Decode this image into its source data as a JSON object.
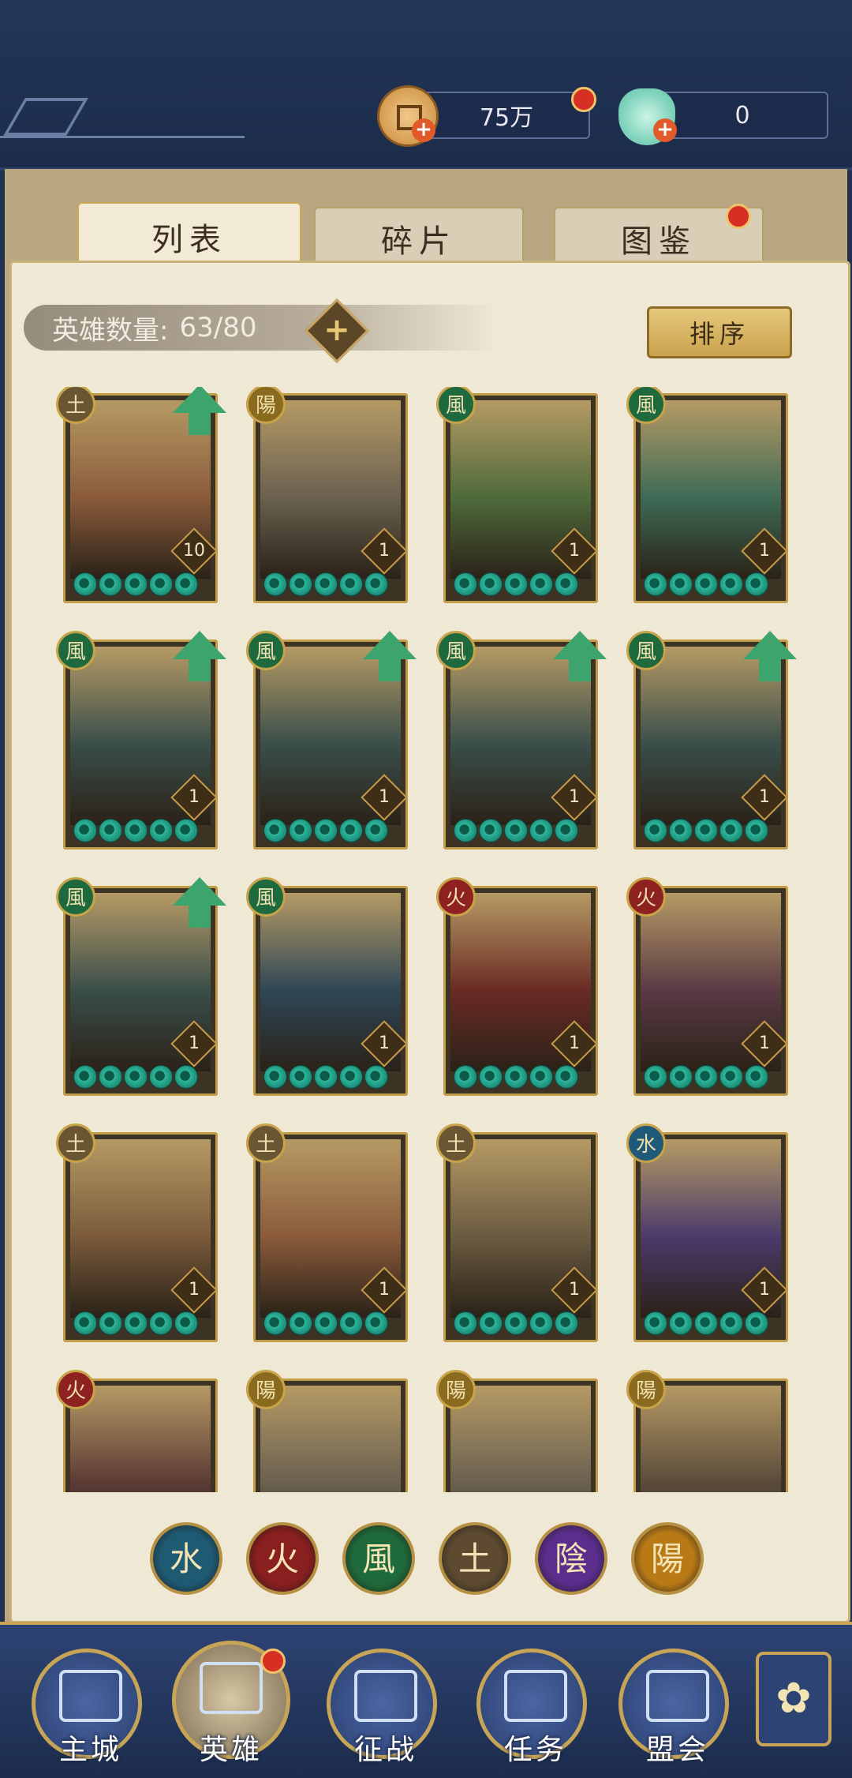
{
  "currencies": [
    {
      "name": "coin",
      "value": "75万",
      "icon": "copper-coin-icon"
    },
    {
      "name": "jade",
      "value": "0",
      "icon": "jade-shell-icon"
    }
  ],
  "tabs": [
    {
      "label": "列表",
      "active": true
    },
    {
      "label": "碎片",
      "active": false
    },
    {
      "label": "图鉴",
      "active": false,
      "has_dot": true
    }
  ],
  "hero_count": {
    "label": "英雄数量:",
    "value": "63/80"
  },
  "sort_label": "排序",
  "heroes": [
    {
      "element": "土",
      "level": "10",
      "upgrade": true
    },
    {
      "element": "陽",
      "level": "1",
      "upgrade": false
    },
    {
      "element": "風",
      "level": "1",
      "upgrade": false
    },
    {
      "element": "風",
      "level": "1",
      "upgrade": false
    },
    {
      "element": "風",
      "level": "1",
      "upgrade": true
    },
    {
      "element": "風",
      "level": "1",
      "upgrade": true
    },
    {
      "element": "風",
      "level": "1",
      "upgrade": true
    },
    {
      "element": "風",
      "level": "1",
      "upgrade": true
    },
    {
      "element": "風",
      "level": "1",
      "upgrade": true
    },
    {
      "element": "風",
      "level": "1",
      "upgrade": false
    },
    {
      "element": "火",
      "level": "1",
      "upgrade": false
    },
    {
      "element": "火",
      "level": "1",
      "upgrade": false
    },
    {
      "element": "土",
      "level": "1",
      "upgrade": false
    },
    {
      "element": "土",
      "level": "1",
      "upgrade": false
    },
    {
      "element": "土",
      "level": "1",
      "upgrade": false
    },
    {
      "element": "水",
      "level": "1",
      "upgrade": false
    },
    {
      "element": "火",
      "level": "",
      "upgrade": false
    },
    {
      "element": "陽",
      "level": "",
      "upgrade": false
    },
    {
      "element": "陽",
      "level": "",
      "upgrade": false
    },
    {
      "element": "陽",
      "level": "",
      "upgrade": false
    }
  ],
  "filters": [
    {
      "glyph": "水",
      "color": "#1f5a73"
    },
    {
      "glyph": "火",
      "color": "#8a1f1f"
    },
    {
      "glyph": "風",
      "color": "#1f6a3a"
    },
    {
      "glyph": "土",
      "color": "#5d4a30"
    },
    {
      "glyph": "陰",
      "color": "#5b2d8c"
    },
    {
      "glyph": "陽",
      "color": "#b97a16"
    }
  ],
  "element_colors": {
    "土": "#6b5634",
    "陽": "#8a6a1e",
    "風": "#1e6a3e",
    "火": "#8e2220",
    "水": "#1f5a78"
  },
  "nav": [
    {
      "label": "主城",
      "icon": "city-gate-icon"
    },
    {
      "label": "英雄",
      "icon": "hero-portrait-icon",
      "active": true,
      "has_dot": true
    },
    {
      "label": "征战",
      "icon": "battle-icon"
    },
    {
      "label": "任务",
      "icon": "task-scroll-icon"
    },
    {
      "label": "盟会",
      "icon": "alliance-pavilion-icon"
    }
  ],
  "menu_icon": "flower-menu-icon"
}
